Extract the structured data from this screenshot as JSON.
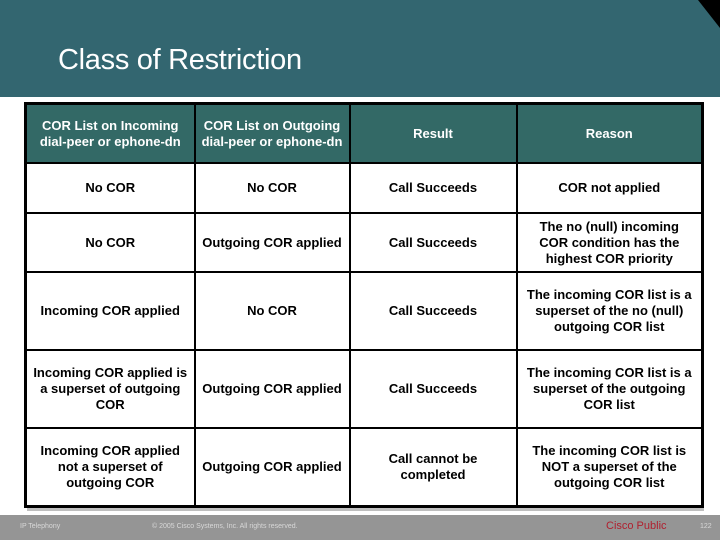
{
  "slide": {
    "title": "Class of Restriction",
    "colors": {
      "banner": "#336670",
      "table_header": "#336966",
      "footer": "#959595",
      "classification": "#b01f2e"
    }
  },
  "table": {
    "headers": [
      "COR List on Incoming dial-peer or ephone-dn",
      "COR List on Outgoing dial-peer or ephone-dn",
      "Result",
      "Reason"
    ],
    "rows": [
      {
        "incoming": "No COR",
        "outgoing": "No COR",
        "result": "Call Succeeds",
        "reason": "COR not applied"
      },
      {
        "incoming": "No COR",
        "outgoing": "Outgoing COR applied",
        "result": "Call Succeeds",
        "reason": "The no (null) incoming COR condition has the highest COR priority"
      },
      {
        "incoming": "Incoming COR applied",
        "outgoing": "No COR",
        "result": "Call Succeeds",
        "reason": "The incoming COR list is a superset of the no (null) outgoing COR list"
      },
      {
        "incoming": "Incoming COR applied is a superset of outgoing COR",
        "outgoing": "Outgoing COR applied",
        "result": "Call Succeeds",
        "reason": "The incoming COR list is a superset of the outgoing COR list"
      },
      {
        "incoming": "Incoming COR applied not a superset of outgoing COR",
        "outgoing": "Outgoing COR applied",
        "result": "Call cannot be completed",
        "reason": "The incoming COR list is NOT a superset of the outgoing COR list"
      }
    ]
  },
  "footer": {
    "course": "IP Telephony",
    "copyright": "© 2005 Cisco Systems, Inc. All rights reserved.",
    "classification": "Cisco Public",
    "page_number": "122"
  }
}
